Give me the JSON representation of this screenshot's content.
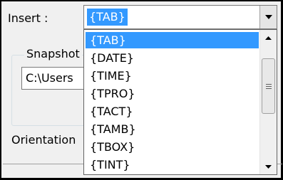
{
  "insert_label": "Insert :",
  "combo": {
    "selected_value": "{TAB}"
  },
  "snapshot_group": {
    "title": "Snapshot",
    "path_value": "C:\\Users"
  },
  "orientation_label": "Orientation",
  "dropdown_options": [
    {
      "label": "{TAB}",
      "selected": true
    },
    {
      "label": "{DATE}"
    },
    {
      "label": "{TIME}"
    },
    {
      "label": "{TPRO}"
    },
    {
      "label": "{TACT}"
    },
    {
      "label": "{TAMB}"
    },
    {
      "label": "{TBOX}"
    },
    {
      "label": "{TINT}"
    }
  ],
  "colors": {
    "selection": "#3399ff",
    "panel_bg": "#f0f0f0"
  },
  "icons": {
    "dropdown_arrow": "chevron-down-icon",
    "scroll_up": "arrow-up-icon",
    "scroll_down": "arrow-down-icon",
    "scroll_grip": "grip-icon"
  }
}
